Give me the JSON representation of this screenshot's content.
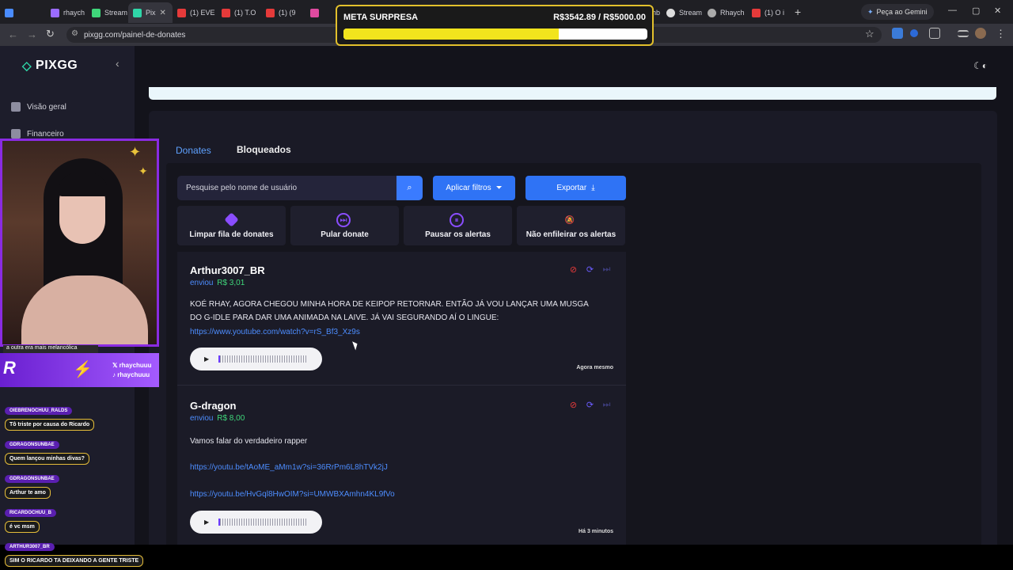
{
  "browser": {
    "tabs": [
      {
        "label": "",
        "color": "#4a8cff"
      },
      {
        "label": "rhaych",
        "color": "#9b6bff"
      },
      {
        "label": "Stream",
        "color": "#3fd67a"
      },
      {
        "label": "Pix",
        "color": "#2fd6a8",
        "active": true
      },
      {
        "label": "(1) EVE",
        "color": "#e53a3a"
      },
      {
        "label": "(1) T.O",
        "color": "#e53a3a"
      },
      {
        "label": "(1) (9",
        "color": "#e53a3a"
      },
      {
        "label": "",
        "color": "#e04aa0"
      },
      {
        "label": "Dashb",
        "color": "#888888"
      },
      {
        "label": "Stream",
        "color": "#dddddd"
      },
      {
        "label": "Rhaych",
        "color": "#aaaaaa"
      },
      {
        "label": "(1) O i",
        "color": "#e53a3a"
      }
    ],
    "gemini_label": "Peça ao Gemini",
    "url": "pixgg.com/painel-de-donates"
  },
  "meta": {
    "title": "META SURPRESA",
    "amount": "R$3542.89 / R$5000.00",
    "progress": 0.7086
  },
  "sidebar": {
    "logo": "PIXGG",
    "items": [
      {
        "label": "Visão geral"
      },
      {
        "label": "Financeiro"
      }
    ]
  },
  "main": {
    "tabs": [
      {
        "label": "Donates"
      },
      {
        "label": "Bloqueados"
      }
    ],
    "search_placeholder": "Pesquise pelo nome de usuário",
    "filter_label": "Aplicar filtros",
    "export_label": "Exportar",
    "actions": [
      {
        "label": "Limpar fila de donates",
        "icon": "eraser-icon"
      },
      {
        "label": "Pular donate",
        "icon": "skip-icon"
      },
      {
        "label": "Pausar os alertas",
        "icon": "pause-icon"
      },
      {
        "label": "Não enfileirar os alertas",
        "icon": "bell-off-icon"
      }
    ],
    "donations": [
      {
        "name": "Arthur3007_BR",
        "sent_label": "enviou",
        "amount": "R$ 3,01",
        "message": "KOÉ RHAY, AGORA CHEGOU MINHA HORA DE KEIPOP RETORNAR. ENTÃO JÁ VOU LANÇAR UMA MUSGA DO G-IDLE PARA DAR UMA ANIMADA NA LAIVE. JÁ VAI SEGURANDO AÍ O LINGUE:",
        "links": [
          "https://www.youtube.com/watch?v=rS_Bf3_Xz9s"
        ],
        "time": "Agora mesmo"
      },
      {
        "name": "G-dragon",
        "sent_label": "enviou",
        "amount": "R$ 8,00",
        "message": "Vamos falar do verdadeiro rapper",
        "links": [
          "https://youtu.be/tAoME_aMm1w?si=36RrPm6L8hTVk2jJ",
          "https://youtu.be/HvGql8HwOIM?si=UMWBXAmhn4KL9fVo"
        ],
        "time": "Há 3 minutos"
      }
    ]
  },
  "stream_overlay": {
    "caption": "a outra era mais melancólica",
    "social_x": "rhaychuuu",
    "social_tiktok": "rhaychuuu",
    "chat": [
      {
        "user": "OIEBRENOCHUU_RALDS",
        "msg": "Tô triste por causa do Ricardo"
      },
      {
        "user": "GDRAGONSUNBAE",
        "msg": "Quem lançou minhas divas?"
      },
      {
        "user": "GDRAGONSUNBAE",
        "msg": "Arthur te amo"
      },
      {
        "user": "RICARDOCHUU_B",
        "msg": "é vc msm"
      },
      {
        "user": "ARTHUR3007_BR",
        "msg": "SIM O RICARDO TA DEIXANDO A GENTE TRISTE"
      }
    ]
  }
}
